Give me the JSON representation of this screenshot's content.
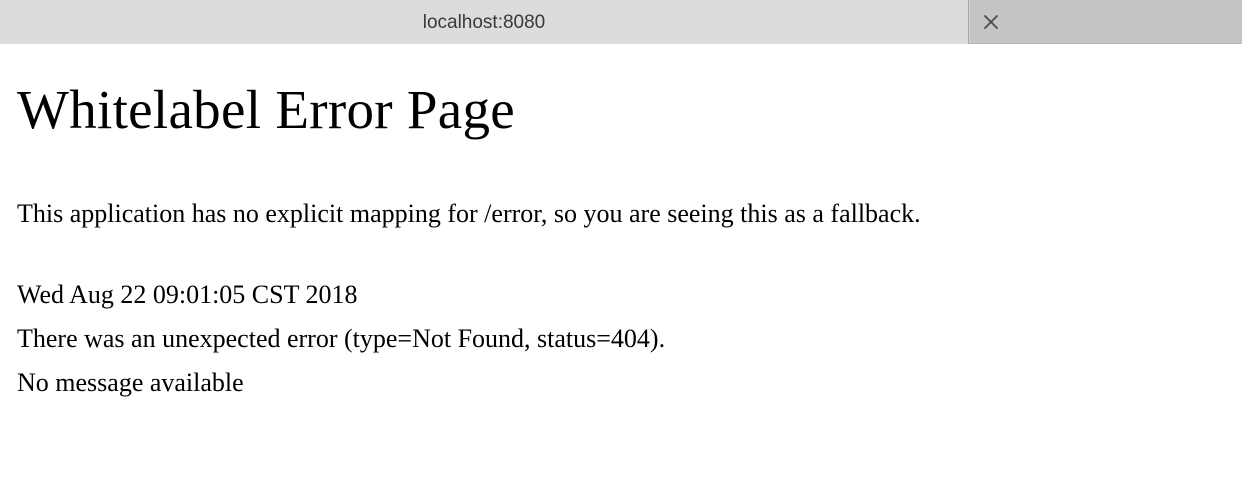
{
  "browser": {
    "tab_title": "localhost:8080",
    "close_icon": "close-icon"
  },
  "page": {
    "heading": "Whitelabel Error Page",
    "fallback_message": "This application has no explicit mapping for /error, so you are seeing this as a fallback.",
    "timestamp": "Wed Aug 22 09:01:05 CST 2018",
    "error_line": "There was an unexpected error (type=Not Found, status=404).",
    "message": "No message available"
  }
}
